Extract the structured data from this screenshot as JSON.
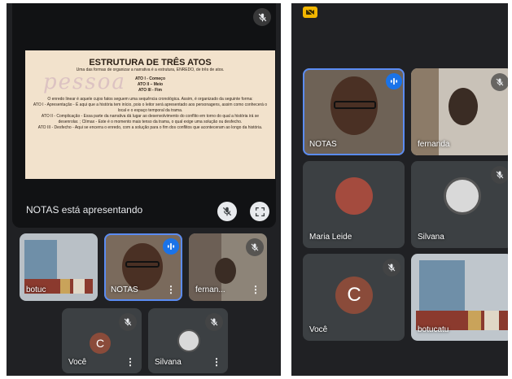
{
  "left": {
    "presenting_label": "NOTAS está apresentando",
    "slide": {
      "watermark": "pessoa",
      "title": "ESTRUTURA DE TRÊS ATOS",
      "subtitle": "Uma das formas de organizar a narrativa é a estrutura, ENREDO, de três de atos.",
      "acts": [
        "ATO I - Começo",
        "ATO II – Meio",
        "ATO III - Fim"
      ],
      "paragraphs": [
        "O enredo linear é aquele cujos fatos seguem uma sequência cronológica. Assim, é organizado da seguinte forma:",
        "ATO I - Apresentação - É aqui que a história tem início, pois o leitor será apresentado aos personagens, assim como conhecerá o local e o espaço temporal da trama.",
        "ATO II - Complicação - Essa parte da narrativa dá lugar ao desenvolvimento do conflito em torno do qual a história irá se desenrolar. ; Clímax - Este é o momento mais tenso da trama, o qual exige uma solução ou desfecho.",
        "ATO III - Desfecho - Aqui se encerra o enredo, com a solução para o fim dos conflitos que aconteceram ao longo da história."
      ]
    },
    "tiles": [
      {
        "name": "botuc"
      },
      {
        "name": "NOTAS"
      },
      {
        "name": "fernan..."
      },
      {
        "name": "Você",
        "initial": "C"
      },
      {
        "name": "Silvana"
      }
    ]
  },
  "right": {
    "tiles": [
      {
        "name": "NOTAS"
      },
      {
        "name": "fernanda"
      },
      {
        "name": "Maria Leide"
      },
      {
        "name": "Silvana"
      },
      {
        "name": "Você",
        "initial": "C"
      },
      {
        "name": "botucatu"
      }
    ]
  },
  "colors": {
    "background": "#202124",
    "tile": "#3c4043",
    "active_outline": "#5b8cf2",
    "avatar": "#8a4b3a",
    "speaking": "#1a73e8",
    "slide_bg": "#f2e2cc"
  }
}
